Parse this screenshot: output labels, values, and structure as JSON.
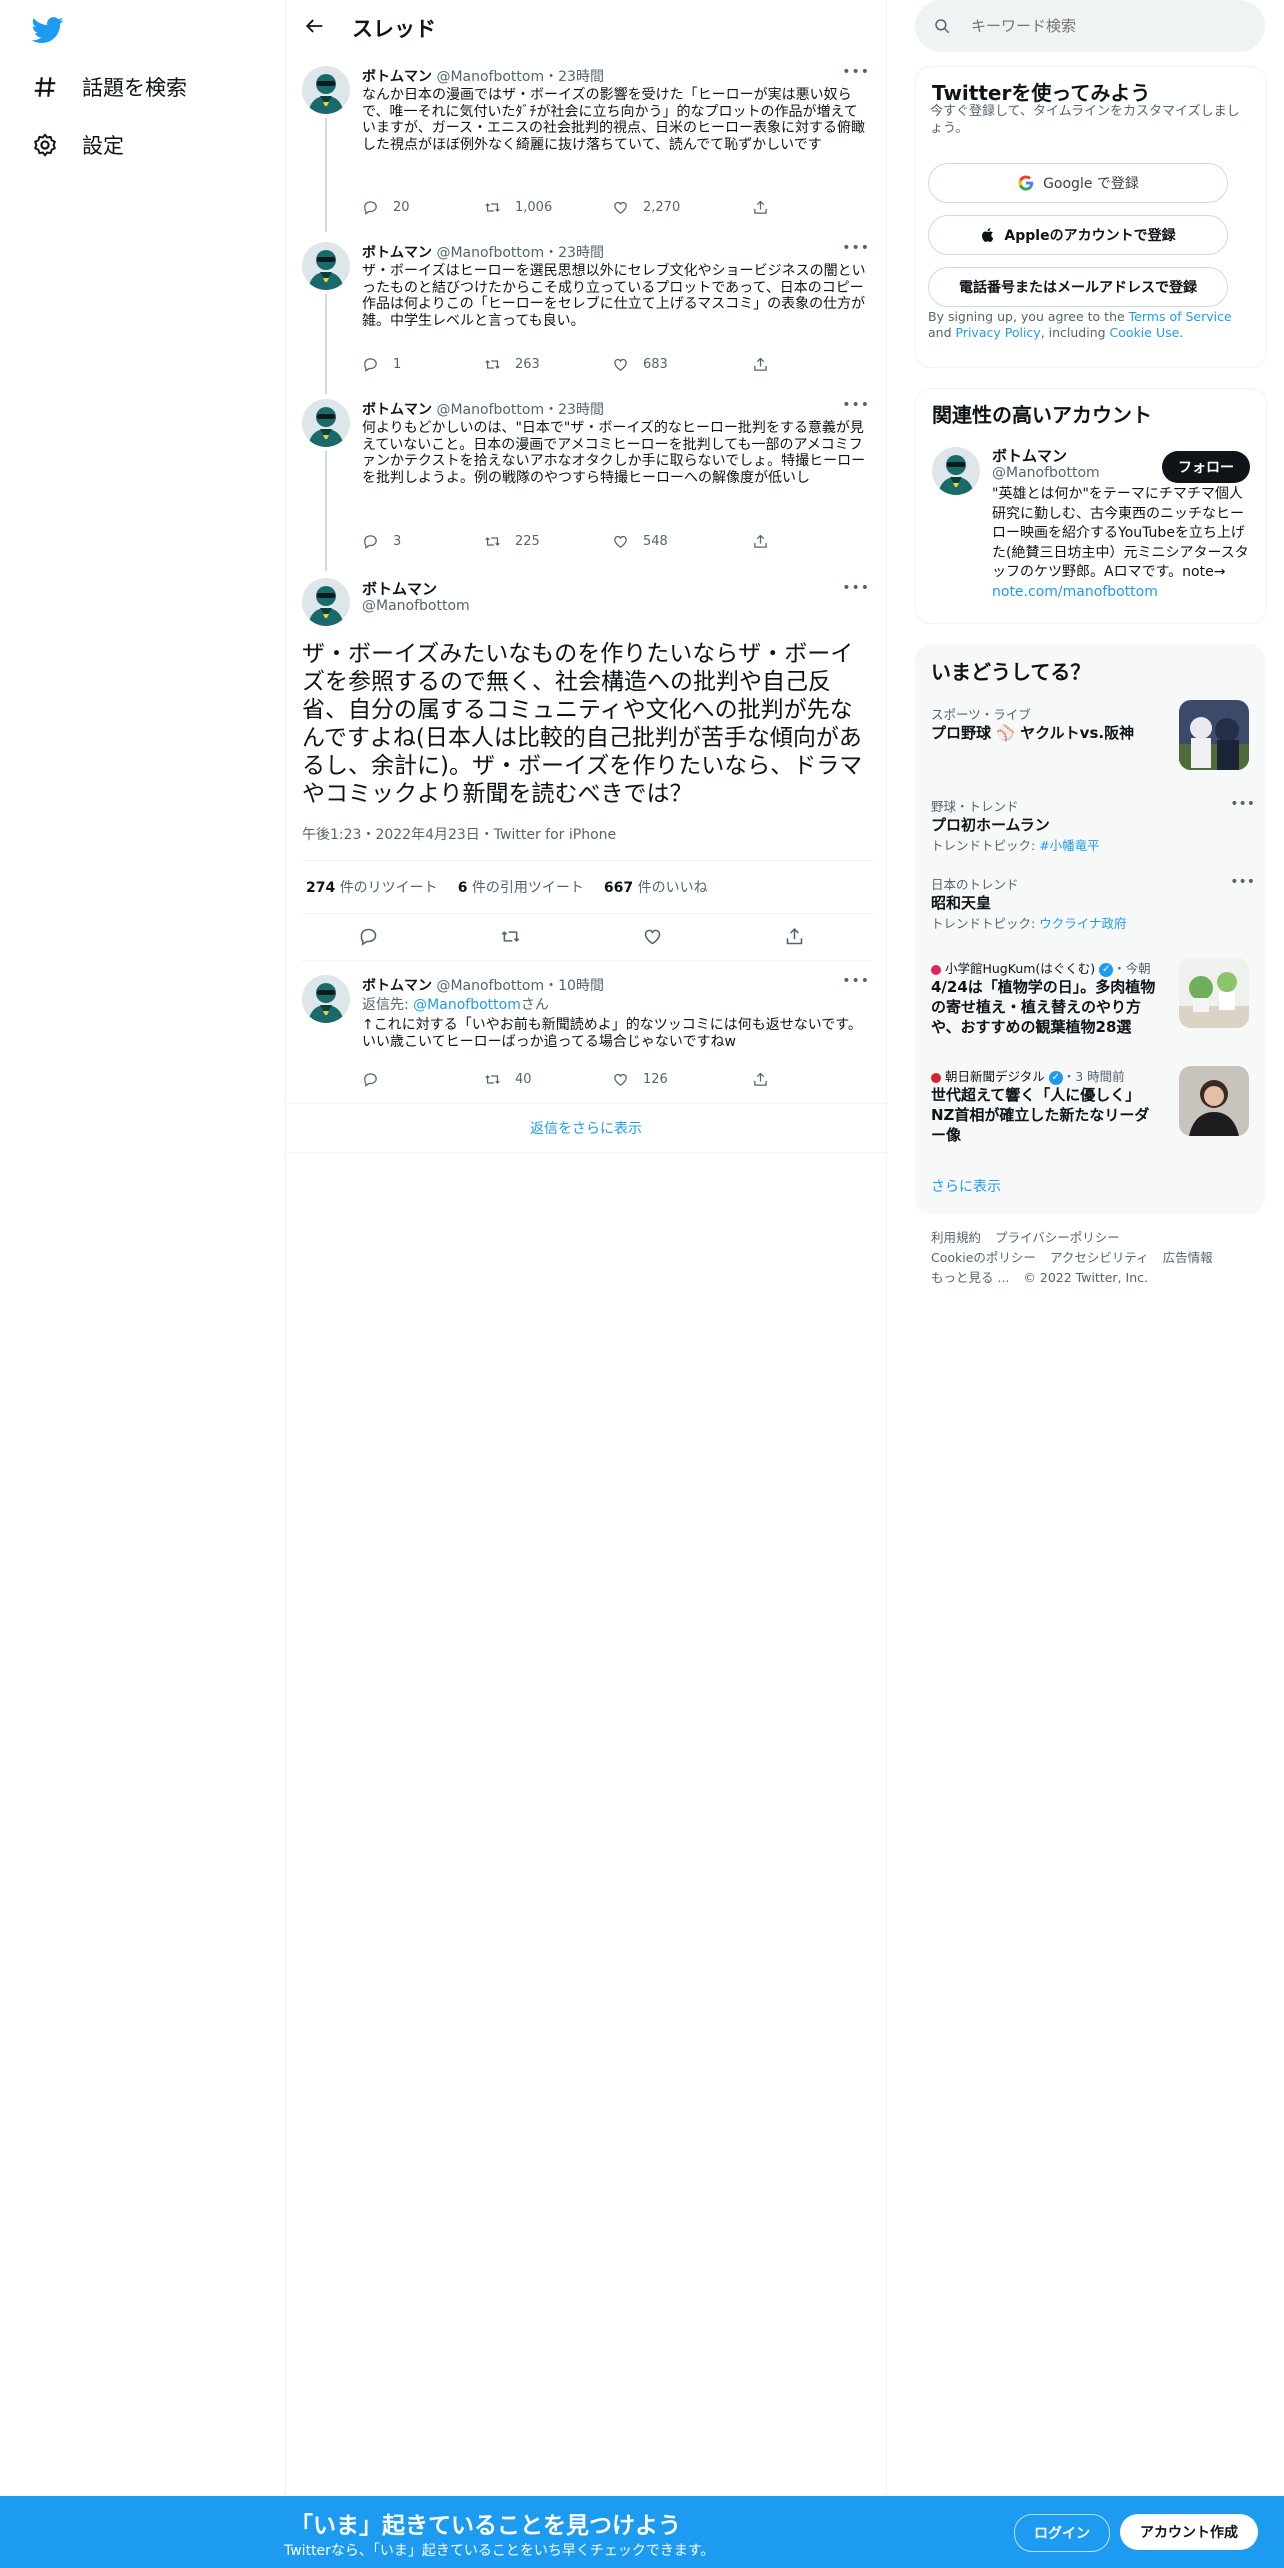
{
  "nav": {
    "items": [
      {
        "label": "話題を検索",
        "icon": "hashtag-icon"
      },
      {
        "label": "設定",
        "icon": "gear-icon"
      }
    ]
  },
  "header": {
    "title": "スレッド"
  },
  "tweets": [
    {
      "name": "ボトムマン",
      "handle": "@Manofbottom",
      "time": "・23時間",
      "text": "なんか日本の漫画ではザ・ボーイズの影響を受けた「ヒーローが実は悪い奴らで、唯一それに気付いたﾀﾞﾁが社会に立ち向かう」的なプロットの作品が増えていますが、ガース・エニスの社会批判的視点、日米のヒーロー表象に対する俯瞰した視点がほぼ例外なく綺麗に抜け落ちていて、読んでて恥ずかしいです",
      "replies": "20",
      "retweets": "1,006",
      "likes": "2,270"
    },
    {
      "name": "ボトムマン",
      "handle": "@Manofbottom",
      "time": "・23時間",
      "text": "ザ・ボーイズはヒーローを選民思想以外にセレブ文化やショービジネスの闇といったものと結びつけたからこそ成り立っているプロットであって、日本のコピー作品は何よりこの「ヒーローをセレブに仕立て上げるマスコミ」の表象の仕方が雑。中学生レベルと言っても良い。",
      "replies": "1",
      "retweets": "263",
      "likes": "683"
    },
    {
      "name": "ボトムマン",
      "handle": "@Manofbottom",
      "time": "・23時間",
      "text": "何よりもどかしいのは、\"日本で\"ザ・ボーイズ的なヒーロー批判をする意義が見えていないこと。日本の漫画でアメコミヒーローを批判しても一部のアメコミファンかテクストを拾えないアホなオタクしか手に取らないでしょ。特撮ヒーローを批判しようよ。例の戦隊のやつすら特撮ヒーローへの解像度が低いし",
      "replies": "3",
      "retweets": "225",
      "likes": "548"
    }
  ],
  "focus": {
    "name": "ボトムマン",
    "handle": "@Manofbottom",
    "text": "ザ・ボーイズみたいなものを作りたいならザ・ボーイズを参照するので無く、社会構造への批判や自己反省、自分の属するコミュニティや文化への批判が先なんですよね(日本人は比較的自己批判が苦手な傾向があるし、余計に)。ザ・ボーイズを作りたいなら、ドラマやコミックより新聞を読むべきでは？",
    "meta": "午後1:23・2022年4月23日・Twitter for iPhone",
    "retweets_num": "274",
    "retweets_label": "件のリツイート",
    "quotes_num": "6",
    "quotes_label": "件の引用ツイート",
    "likes_num": "667",
    "likes_label": "件のいいね"
  },
  "reply": {
    "name": "ボトムマン",
    "handle": "@Manofbottom",
    "time": "・10時間",
    "reply_to_prefix": "返信先: ",
    "reply_to_handle": "@Manofbottom",
    "reply_to_suffix": "さん",
    "text": "↑これに対する「いやお前も新聞読めよ」的なツッコミには何も返せないです。いい歳こいてヒーローばっか追ってる場合じゃないですねw",
    "replies": "",
    "retweets": "40",
    "likes": "126"
  },
  "show_more_replies": "返信をさらに表示",
  "search": {
    "placeholder": "キーワード検索"
  },
  "signup": {
    "title": "Twitterを使ってみよう",
    "subtitle": "今すぐ登録して、タイムラインをカスタマイズしましょう。",
    "google": "Google で登録",
    "apple": "Appleのアカウントで登録",
    "phone": "電話番号またはメールアドレスで登録",
    "terms_pre": "By signing up, you agree to the ",
    "terms_tos": "Terms of Service",
    "terms_and": " and ",
    "terms_privacy": "Privacy Policy",
    "terms_including": ", including ",
    "terms_cookie": "Cookie Use",
    "terms_end": "."
  },
  "related": {
    "title": "関連性の高いアカウント",
    "name": "ボトムマン",
    "handle": "@Manofbottom",
    "bio": "\"英雄とは何か\"をテーマにチマチマ個人研究に勤しむ、古今東西のニッチなヒーロー映画を紹介するYouTubeを立ち上げた(絶賛三日坊主中）元ミニシアタースタッフのケツ野郎。Aロマです。note→ ",
    "bio_link": "note.com/manofbottom",
    "follow": "フォロー"
  },
  "trends": {
    "title": "いまどうしてる？",
    "items": [
      {
        "ctx": "スポーツ・ライブ",
        "title": "プロ野球 ⚾ ヤクルトvs.阪神"
      },
      {
        "ctx": "野球・トレンド",
        "title": "プロ初ホームラン",
        "sub_label": "トレンドトピック: ",
        "sub_link": "#小幡竜平"
      },
      {
        "ctx": "日本のトレンド",
        "title": "昭和天皇",
        "sub_label": "トレンドトピック: ",
        "sub_link": "ウクライナ政府"
      },
      {
        "source": "小学館HugKum(はぐくむ)",
        "time": "・今朝",
        "title": "4/24は「植物学の日」。多肉植物の寄せ植え・植え替えのやり方や、おすすめの観葉植物28選"
      },
      {
        "source": "朝日新聞デジタル",
        "time": "・3 時間前",
        "title": "世代超えて響く「人に優しく」 NZ首相が確立した新たなリーダー像"
      }
    ],
    "show_more": "さらに表示"
  },
  "footer": {
    "links": [
      "利用規約",
      "プライバシーポリシー",
      "Cookieのポリシー",
      "アクセシビリティ",
      "広告情報",
      "もっと見る ..."
    ],
    "copyright": "© 2022 Twitter, Inc."
  },
  "bottombar": {
    "title": "「いま」起きていることを見つけよう",
    "subtitle": "Twitterなら、「いま」起きていることをいち早くチェックできます。",
    "login": "ログイン",
    "signup": "アカウント作成"
  },
  "colors": {
    "accent": "#1d9bf0",
    "text": "#0f1419",
    "muted": "#536471"
  }
}
